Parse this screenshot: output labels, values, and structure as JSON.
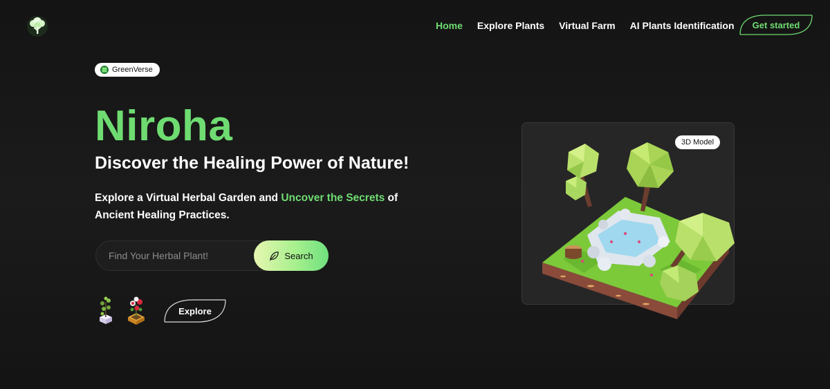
{
  "nav": {
    "links": [
      {
        "label": "Home",
        "active": true
      },
      {
        "label": "Explore Plants",
        "active": false
      },
      {
        "label": "Virtual Farm",
        "active": false
      },
      {
        "label": "AI Plants Identification",
        "active": false
      }
    ],
    "cta_label": "Get started"
  },
  "brand": {
    "logo_icon": "tree-logo-icon",
    "badge_label": "GreenVerse"
  },
  "hero": {
    "title": "Niroha",
    "subtitle": "Discover the Healing Power of Nature!",
    "desc_part1": "Explore a Virtual Herbal Garden and ",
    "desc_highlight": "Uncover the Secrets",
    "desc_part2": " of Ancient Healing Practices."
  },
  "search": {
    "placeholder": "Find Your Herbal Plant!",
    "value": "",
    "button_label": "Search",
    "button_icon": "leaf-icon"
  },
  "explore": {
    "label": "Explore",
    "plant_icons": [
      "potted-plant-icon",
      "flower-planter-icon"
    ]
  },
  "model": {
    "badge_label": "3D Model"
  },
  "colors": {
    "accent": "#6fdc72",
    "background": "#161616",
    "card": "#262626"
  }
}
